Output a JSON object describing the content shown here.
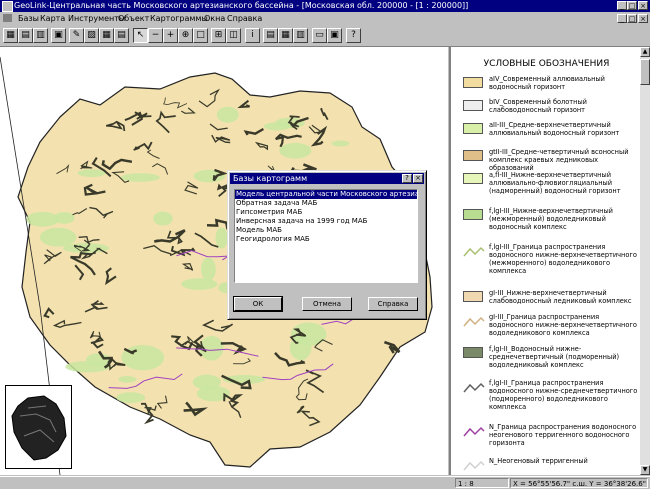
{
  "window": {
    "title": "GeoLink-Центральная часть Московского артезианского бассейна - [Московская обл. 200000 - [1 : 200000]]",
    "controls": [
      "_",
      "□",
      "×"
    ]
  },
  "menu": [
    "Базы",
    "Карта",
    "Инструменты",
    "Объект",
    "Картограммы",
    "Окна",
    "Справка"
  ],
  "toolbar": {
    "buttons": [
      {
        "name": "open-map-button",
        "icon": "▦"
      },
      {
        "name": "layers-button",
        "icon": "▤"
      },
      {
        "name": "copy-map-button",
        "icon": "▥"
      },
      {
        "name": "map-tool-button",
        "icon": "▣"
      },
      {
        "name": "edit-object-button",
        "icon": "✎"
      },
      {
        "name": "chart-button",
        "icon": "▨"
      },
      {
        "name": "table-button",
        "icon": "▦"
      },
      {
        "name": "print-button",
        "icon": "▤"
      },
      {
        "name": "pointer-button",
        "icon": "↖"
      },
      {
        "name": "zoom-out-button",
        "icon": "−"
      },
      {
        "name": "zoom-in-button",
        "icon": "+"
      },
      {
        "name": "zoom-window-button",
        "icon": "⊕"
      },
      {
        "name": "pan-button",
        "icon": "□"
      },
      {
        "name": "measure-button",
        "icon": "⊞"
      },
      {
        "name": "select-region-button",
        "icon": "◫"
      },
      {
        "name": "info-button",
        "icon": "i"
      },
      {
        "name": "attributes-button",
        "icon": "▤"
      },
      {
        "name": "legend-toggle-button",
        "icon": "▦"
      },
      {
        "name": "grid-button",
        "icon": "▥"
      },
      {
        "name": "print-preview-button",
        "icon": "▭"
      },
      {
        "name": "export-button",
        "icon": "▣"
      },
      {
        "name": "help-button",
        "icon": "?"
      }
    ]
  },
  "legend": {
    "title": "УСЛОВНЫЕ ОБОЗНАЧЕНИЯ",
    "items": [
      {
        "label": "aIV_Современный аллювиальный водоносный горизонт",
        "color": "#f3dca0",
        "kind": "fill"
      },
      {
        "label": "bIV_Современный болотный слабоводоносный горизонт",
        "color": "#eeeeee",
        "kind": "fill"
      },
      {
        "label": "aII-III_Средне-верхнечетвертичный аллювиальный водоносный горизонт",
        "color": "#d8f0a8",
        "kind": "fill"
      },
      {
        "label": "gtII-III_Средне-четвертичный всоносный комплекс краевых ледниковых образований",
        "color": "#e0bf88",
        "kind": "fill"
      },
      {
        "label": "a,fI-III_Нижне-верхнечетвертичный аллювиально-флювиогляциальный (надморенный) водоносный горизонт",
        "color": "#e6f5b8",
        "kind": "fill"
      },
      {
        "label": "f,lgI-III_Нижне-верхнечетвертичный (межморенный) водоледниковый водоносный комплекс",
        "color": "#b8dc90",
        "kind": "fill"
      },
      {
        "label": "f,lgI-III_Граница распространения водоносного нижне-верхнечетвертичного (межморенного) водоледникового комплекса",
        "color": "#a8c070",
        "kind": "line"
      },
      {
        "label": "gI-III_Нижне-верхнечетвертичный слабоводоносный ледниковый комплекс",
        "color": "#f0d8b0",
        "kind": "fill"
      },
      {
        "label": "gI-III_Граница распространения водоносного нижне-верхнечетвертичного водоледникового комплекса",
        "color": "#d0b080",
        "kind": "line"
      },
      {
        "label": "f,lgI-II_Водоносный нижне-среднечетвертичный (подморенный) водоледниковый комплекс",
        "color": "#7a8a68",
        "kind": "fill"
      },
      {
        "label": "f,lgI-II_Граница распространения водоносного нижне-среднечетвертичного (подморенного) водоледникового комплекса",
        "color": "#606060",
        "kind": "line"
      },
      {
        "label": "N_Граница распространения водоносного неогенового терригенного водоносного горизонта",
        "color": "#a040a0",
        "kind": "line"
      },
      {
        "label": "N_Неогеновый терригенный",
        "color": "#d0d0d0",
        "kind": "line"
      }
    ]
  },
  "status": {
    "scale": "1 : 8",
    "coordinates": "X = 56°55'56.7\" с.ш.  Y = 36°38'26.6\" в.д."
  },
  "dialog": {
    "title": "Базы картограмм",
    "controls": [
      "?",
      "×"
    ],
    "items": [
      "Модель центральной части Московского артезианского",
      "Обратная задача МАБ",
      "Гипсометрия  МАБ",
      "Инверсная задача на 1999 год МАБ",
      "Модель МАБ",
      "Геогидрология МАБ"
    ],
    "selected_index": 0,
    "buttons": {
      "ok": "ОК",
      "cancel": "Отмена",
      "help": "Справка"
    }
  },
  "colors": {
    "title_bar": "#000080",
    "map_region_fill": "#f3e2b0",
    "map_green": "#c8e6a0",
    "map_dark": "#3a3a2a",
    "river": "#a040c0"
  }
}
